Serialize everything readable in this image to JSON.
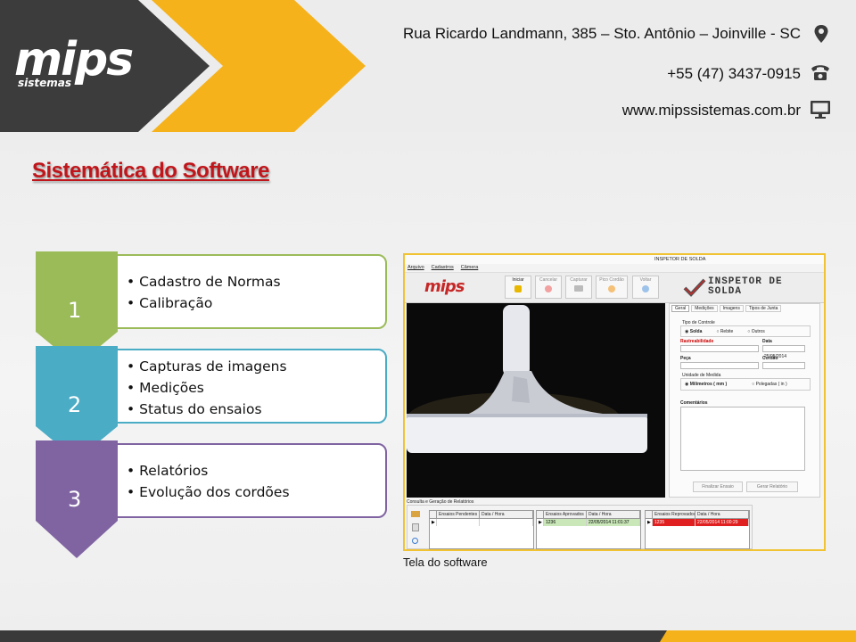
{
  "header": {
    "logo_text": "mips",
    "logo_subtext": "sistemas",
    "address": "Rua Ricardo Landmann, 385 – Sto. Antônio – Joinville - SC",
    "phone": "+55 (47) 3437-0915",
    "website": "www.mipssistemas.com.br",
    "icons": [
      "map-pin-icon",
      "telephone-icon",
      "monitor-icon"
    ]
  },
  "section_title": "Sistemática do Software",
  "steps": [
    {
      "number": "1",
      "items": [
        "Cadastro de Normas",
        "Calibração"
      ],
      "color": "#9bbb59"
    },
    {
      "number": "2",
      "items": [
        "Capturas de imagens",
        "Medições",
        "Status do ensaios"
      ],
      "color": "#4bacc6"
    },
    {
      "number": "3",
      "items": [
        "Relatórios",
        "Evolução dos cordões"
      ],
      "color": "#8064a2"
    }
  ],
  "software": {
    "window_title": "INSPETOR DE SOLDA",
    "menu": [
      "Arquivo",
      "Cadastros",
      "Câmera"
    ],
    "toolbar": [
      "Iniciar",
      "Cancelar",
      "Capturar",
      "Pico Cordão",
      "Voltar"
    ],
    "brand_logo": "INSPETOR DE SOLDA",
    "tabs": [
      "Geral",
      "Medições",
      "Imagens",
      "Tipos de Junta"
    ],
    "form": {
      "tipo_controle_label": "Tipo de Controle",
      "tipo_options": [
        "Solda",
        "Rebite",
        "Outros"
      ],
      "rastreabilidade_label": "Rastreabilidade",
      "data_label": "Data",
      "data_value": "25/05/2014",
      "peca_label": "Peça",
      "cordao_label": "Cordão",
      "unidade_label": "Unidade de Medida",
      "unidade_options": [
        "Milímetros ( mm )",
        "Polegadas ( in )"
      ],
      "comentarios_label": "Comentários"
    },
    "buttons": [
      "Finalizar Ensaio",
      "Gerar Relatório"
    ],
    "reports_group_label": "Consulta e Geração de Relatórios",
    "tables": [
      {
        "headers": [
          "Ensaios Pendentes",
          "Data / Hora"
        ],
        "rows": []
      },
      {
        "headers": [
          "Ensaios Aprovados",
          "Data / Hora"
        ],
        "rows": [
          [
            "1236",
            "22/05/2014 11:01:37"
          ]
        ]
      },
      {
        "headers": [
          "Ensaios Reprovados",
          "Data / Hora"
        ],
        "rows": [
          [
            "1235",
            "22/05/2014 11:00:29"
          ]
        ]
      }
    ]
  },
  "caption": "Tela do software",
  "colors": {
    "accent_yellow": "#f6b21a",
    "header_dark": "#3a3a3a",
    "title_red": "#c0161b",
    "step1": "#9bbb59",
    "step2": "#4bacc6",
    "step3": "#8064a2"
  }
}
